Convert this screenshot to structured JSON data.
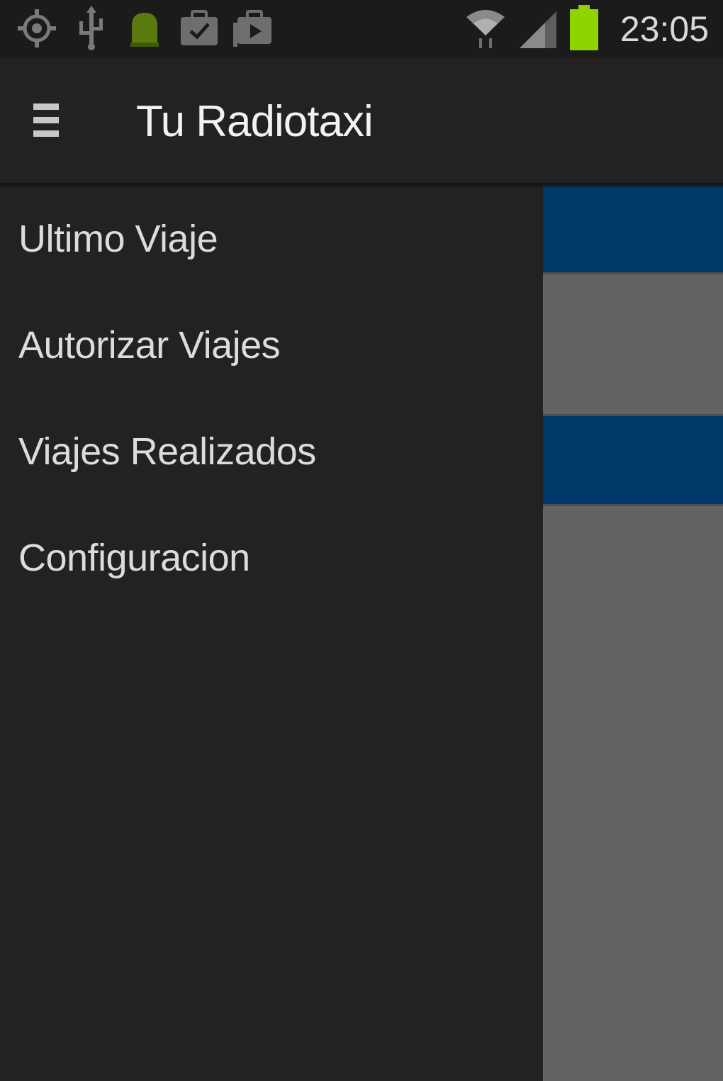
{
  "status_bar": {
    "time": "23:05",
    "icons": [
      "gps-icon",
      "usb-icon",
      "android-notification-icon",
      "task-check-icon",
      "media-bag-icon",
      "wifi-icon",
      "signal-icon",
      "battery-icon"
    ],
    "battery_color": "#8fd400"
  },
  "action_bar": {
    "title": "Tu Radiotaxi",
    "menu_icon": "hamburger-menu-icon"
  },
  "drawer": {
    "items": [
      {
        "label": "Ultimo Viaje"
      },
      {
        "label": "Autorizar Viajes"
      },
      {
        "label": "Viajes Realizados"
      },
      {
        "label": "Configuracion"
      }
    ]
  },
  "colors": {
    "background": "#222222",
    "content_gray": "#636363",
    "content_blue": "#003a6b",
    "text": "#dcdcdc"
  }
}
